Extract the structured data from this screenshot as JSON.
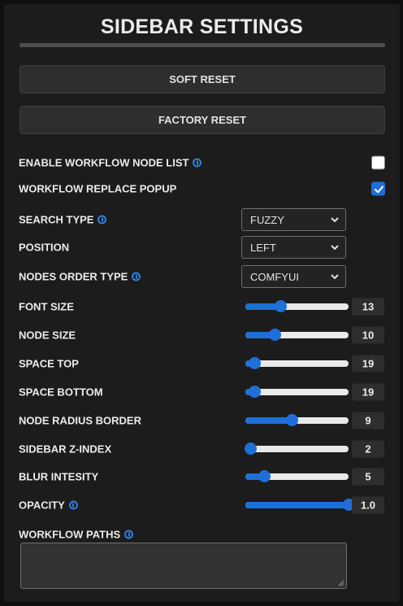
{
  "panel": {
    "title": "SIDEBAR SETTINGS"
  },
  "buttons": {
    "soft_reset": "SOFT RESET",
    "factory_reset": "FACTORY RESET"
  },
  "toggles": [
    {
      "label": "ENABLE WORKFLOW NODE LIST",
      "info": true,
      "checked": false
    },
    {
      "label": "WORKFLOW REPLACE POPUP",
      "info": false,
      "checked": true
    }
  ],
  "selects": [
    {
      "label": "SEARCH TYPE",
      "info": true,
      "value": "FUZZY"
    },
    {
      "label": "POSITION",
      "info": false,
      "value": "LEFT"
    },
    {
      "label": "NODES ORDER TYPE",
      "info": true,
      "value": "COMFYUI"
    }
  ],
  "sliders": [
    {
      "label": "FONT SIZE",
      "info": false,
      "value": "13",
      "fraction": 0.34
    },
    {
      "label": "NODE SIZE",
      "info": false,
      "value": "10",
      "fraction": 0.28
    },
    {
      "label": "SPACE TOP",
      "info": false,
      "value": "19",
      "fraction": 0.09
    },
    {
      "label": "SPACE BOTTOM",
      "info": false,
      "value": "19",
      "fraction": 0.09
    },
    {
      "label": "NODE RADIUS BORDER",
      "info": false,
      "value": "9",
      "fraction": 0.45
    },
    {
      "label": "SIDEBAR Z-INDEX",
      "info": false,
      "value": "2",
      "fraction": 0.05
    },
    {
      "label": "BLUR INTESITY",
      "info": false,
      "value": "5",
      "fraction": 0.18
    },
    {
      "label": "OPACITY",
      "info": true,
      "value": "1.0",
      "fraction": 1.0
    }
  ],
  "workflow_paths": {
    "label": "WORKFLOW PATHS",
    "info": true,
    "value": ""
  },
  "colors": {
    "accent": "#1f6fd8",
    "background": "#1c1c1c",
    "button": "#2e2e2e"
  }
}
